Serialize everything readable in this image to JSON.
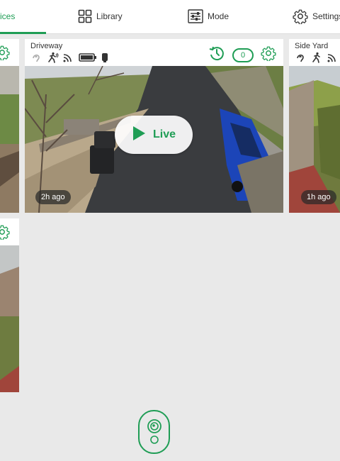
{
  "nav": {
    "devices": "ices",
    "library": "Library",
    "mode": "Mode",
    "settings": "Settings"
  },
  "colors": {
    "accent": "#1f9d55"
  },
  "cameras": [
    {
      "name": "Driveway",
      "timestamp": "2h ago",
      "live_label": "Live",
      "event_count": "0",
      "status_icons": [
        "audio-icon",
        "motion-icon",
        "wifi-icon",
        "battery-icon",
        "camera-icon"
      ]
    },
    {
      "name": "Side Yard",
      "timestamp": "1h ago",
      "status_icons": [
        "audio-icon",
        "motion-icon",
        "wifi-icon"
      ]
    }
  ],
  "icons": {
    "devices": "gear-icon",
    "library": "grid-icon",
    "mode": "sliders-icon",
    "settings": "gear-icon",
    "history": "history-icon",
    "add_camera": "camera-add-icon"
  }
}
